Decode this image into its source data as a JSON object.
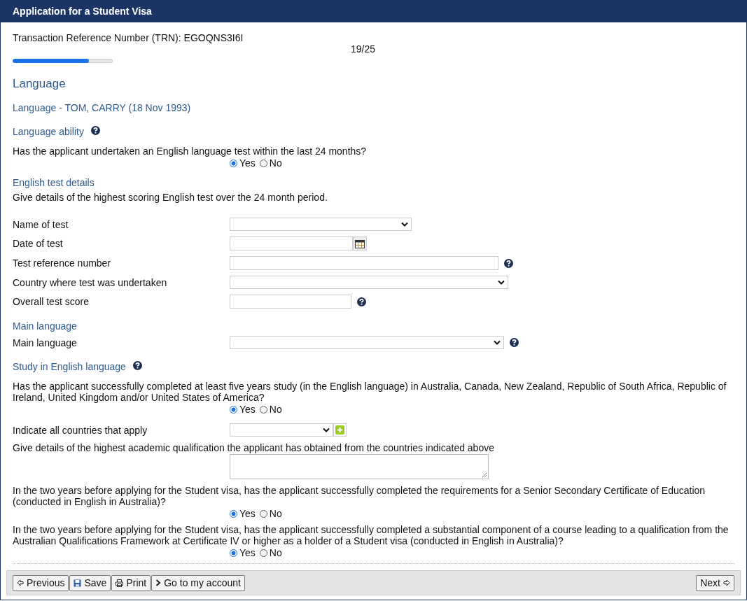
{
  "window": {
    "title": "Application for a Student Visa"
  },
  "trn": "Transaction Reference Number (TRN): EGOQNS3I6I",
  "progress": {
    "reading": "19/25",
    "level": 0.76
  },
  "items": [
    {
      "kind": "heading",
      "text": "Language"
    },
    {
      "kind": "subheading",
      "text": "Language - TOM, CARRY (18 Nov 1993)"
    },
    {
      "kind": "section",
      "text": "Language ability",
      "help": true
    },
    {
      "kind": "question",
      "text": "Has the applicant undertaken an English language test within the last 24 months?",
      "options": [
        {
          "label": "Yes",
          "selected": true
        },
        {
          "label": "No",
          "selected": false
        }
      ]
    },
    {
      "kind": "section",
      "text": "English test details",
      "help": false
    },
    {
      "kind": "note",
      "text": "Give details of the highest scoring English test over the 24 month period."
    },
    {
      "kind": "select",
      "label": "Name of test",
      "help": false
    },
    {
      "kind": "date",
      "label": "Date of test",
      "help": false
    },
    {
      "kind": "text",
      "label": "Test reference number",
      "help": true
    },
    {
      "kind": "select",
      "label": "Country where test was undertaken",
      "help": false
    },
    {
      "kind": "text",
      "label": "Overall test score",
      "help": true
    },
    {
      "kind": "section",
      "text": "Main language",
      "help": false
    },
    {
      "kind": "select",
      "label": "Main language",
      "help": true
    },
    {
      "kind": "section",
      "text": "Study in English language",
      "help": true
    },
    {
      "kind": "question",
      "text": "Has the applicant successfully completed at least five years study (in the English language) in Australia, Canada, New Zealand, Republic of South Africa, Republic of Ireland, United Kingdom and/or United States of America?",
      "options": [
        {
          "label": "Yes",
          "selected": true
        },
        {
          "label": "No",
          "selected": false
        }
      ]
    },
    {
      "kind": "multi",
      "label": "Indicate all countries that apply",
      "help": false
    },
    {
      "kind": "textarea",
      "label": "Give details of the highest academic qualification the applicant has obtained from the countries indicated above",
      "help": false
    },
    {
      "kind": "question",
      "text": "In the two years before applying for the Student visa, has the applicant successfully completed the requirements for a Senior Secondary Certificate of Education (conducted in English in Australia)?",
      "options": [
        {
          "label": "Yes",
          "selected": true
        },
        {
          "label": "No",
          "selected": false
        }
      ]
    },
    {
      "kind": "question",
      "text": "In the two years before applying for the Student visa, has the applicant successfully completed a substantial component of a course leading to a qualification from the Australian Qualifications Framework at Certificate IV or higher as a holder of a Student visa (conducted in English in Australia)?",
      "options": [
        {
          "label": "Yes",
          "selected": true
        },
        {
          "label": "No",
          "selected": false
        }
      ]
    }
  ],
  "buttons": [
    {
      "kind": "previous",
      "label": "Previous"
    },
    {
      "kind": "save",
      "label": "Save"
    },
    {
      "kind": "print",
      "label": "Print"
    },
    {
      "kind": "account",
      "label": "Go to my account"
    }
  ],
  "next_button": {
    "kind": "next",
    "label": "Next"
  }
}
